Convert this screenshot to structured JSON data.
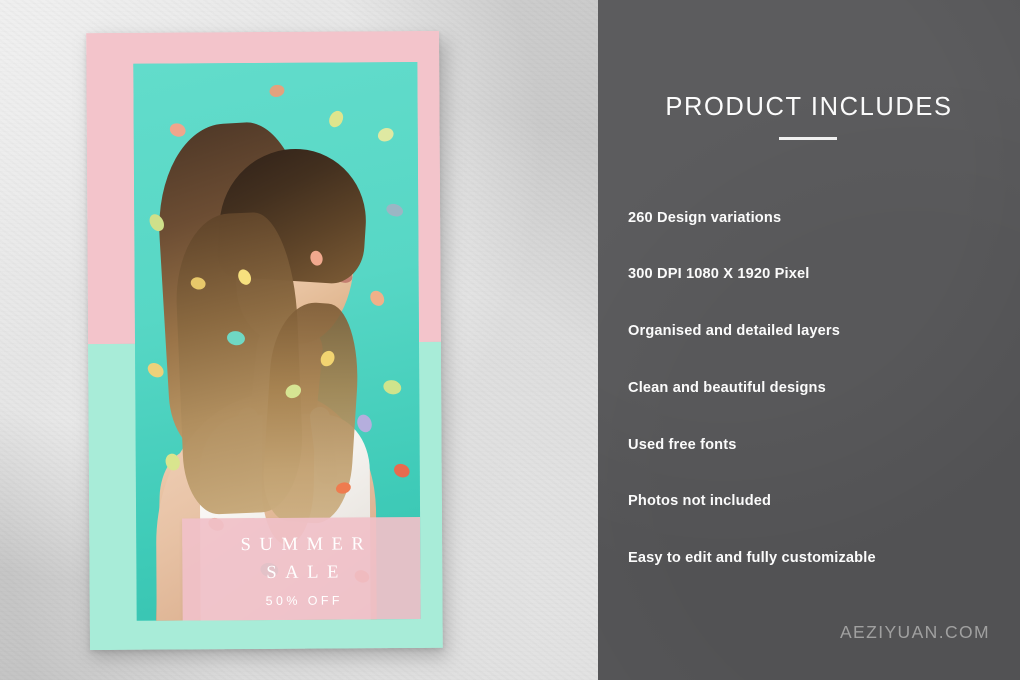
{
  "panel": {
    "title": "PRODUCT INCLUDES",
    "watermark": "AEZIYUAN.COM",
    "features": [
      "260 Design variations",
      "300 DPI 1080 X 1920 Pixel",
      "Organised and detailed layers",
      "Clean and beautiful designs",
      "Used free fonts",
      "Photos not included",
      "Easy to edit and fully customizable"
    ]
  },
  "card": {
    "sale_line1": "SUMMER",
    "sale_line2": "SALE",
    "sale_line3": "50% OFF"
  },
  "colors": {
    "panel_bg": "#565658",
    "left_bg": "#d7d7d7",
    "card_pink": "#f3c4cb",
    "card_mint": "#a8ecd8",
    "photo_teal": "#58d6c6",
    "sale_box_pink": "#f0c1c8",
    "text_white": "#fbfbfb",
    "watermark_gray": "#a9a9a9"
  }
}
